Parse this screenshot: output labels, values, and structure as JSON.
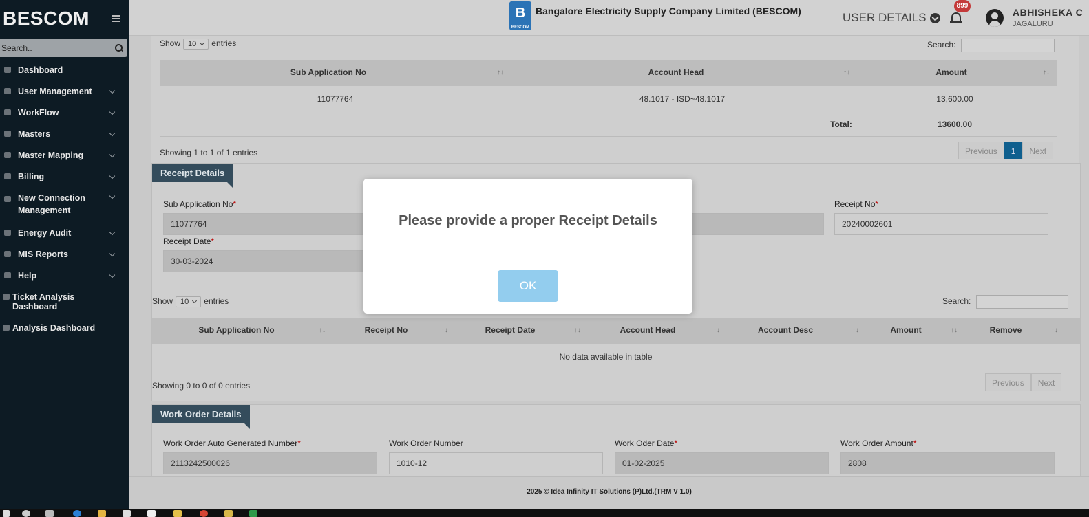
{
  "sidebar": {
    "brand": "BESCOM",
    "search_placeholder": "Search..",
    "items": [
      {
        "label": "Dashboard",
        "chevron": false
      },
      {
        "label": "User Management",
        "chevron": true
      },
      {
        "label": "WorkFlow",
        "chevron": true
      },
      {
        "label": "Masters",
        "chevron": true
      },
      {
        "label": "Master Mapping",
        "chevron": true
      },
      {
        "label": "Billing",
        "chevron": true
      },
      {
        "label": "New Connection Management",
        "chevron": true
      },
      {
        "label": "Energy Audit",
        "chevron": true
      },
      {
        "label": "MIS Reports",
        "chevron": true
      },
      {
        "label": "Help",
        "chevron": true
      },
      {
        "label": "Ticket Analysis Dashboard",
        "chevron": false
      },
      {
        "label": "Analysis Dashboard",
        "chevron": false
      }
    ]
  },
  "header": {
    "logo_letter": "B",
    "logo_caption": "BESCOM",
    "company": "Bangalore Electricity Supply Company Limited (BESCOM)",
    "user_details": "USER DETAILS",
    "notifications": "899",
    "user_name": "ABHISHEKA C",
    "user_location": "JAGALURU"
  },
  "table1": {
    "show": "Show",
    "entries_value": "10",
    "entries": "entries",
    "search": "Search:",
    "headers": [
      "Sub Application No",
      "Account Head",
      "Amount"
    ],
    "sort_glyph": "↑↓",
    "row": [
      "11077764",
      "48.1017 - ISD~48.1017",
      "13,600.00"
    ],
    "total_label": "Total:",
    "total_value": "13600.00",
    "info": "Showing 1 to 1 of 1 entries",
    "pager": [
      "Previous",
      "1",
      "Next"
    ]
  },
  "receipt": {
    "section_title": "Receipt Details",
    "sub_app_label": "Sub Application No",
    "sub_app_value": "11077764",
    "receipt_no_label": "Receipt No",
    "receipt_no_value": "20240002601",
    "receipt_date_label": "Receipt Date",
    "receipt_date_value": "30-03-2024",
    "req": "*"
  },
  "table2": {
    "show": "Show",
    "entries_value": "10",
    "entries": "entries",
    "search": "Search:",
    "headers": [
      "Sub Application No",
      "Receipt No",
      "Receipt Date",
      "Account Head",
      "Account Desc",
      "Amount",
      "Remove"
    ],
    "empty": "No data available in table",
    "info": "Showing 0 to 0 of 0 entries",
    "pager": [
      "Previous",
      "Next"
    ]
  },
  "work_order": {
    "section_title": "Work Order Details",
    "fields": [
      {
        "label": "Work Order Auto Generated Number",
        "required": true,
        "value": "2113242500026"
      },
      {
        "label": "Work Order Number",
        "required": false,
        "value": "1010-12"
      },
      {
        "label": "Work Oder Date",
        "required": true,
        "value": "01-02-2025"
      },
      {
        "label": "Work Order Amount",
        "required": true,
        "value": "2808"
      }
    ]
  },
  "footer": "2025 © Idea Infinity IT Solutions (P)Ltd.(TRM V 1.0)",
  "modal": {
    "message": "Please provide a proper Receipt Details",
    "ok": "OK"
  }
}
